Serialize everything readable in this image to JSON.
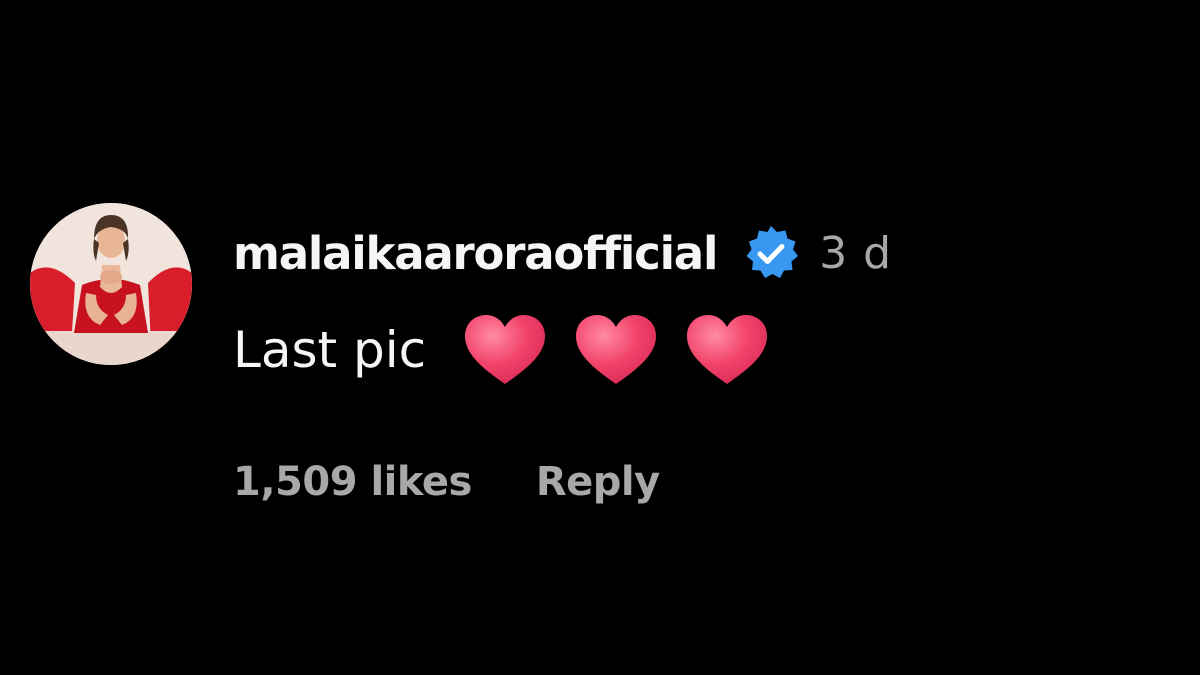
{
  "comment": {
    "avatar_icon": "profile-photo-avatar",
    "username": "malaikaaroraofficial",
    "verified_icon": "verified-badge-icon",
    "time_ago": "3 d",
    "text": "Last pic",
    "emojis": [
      "red-heart-emoji",
      "red-heart-emoji",
      "red-heart-emoji"
    ],
    "likes": "1,509 likes",
    "reply_label": "Reply"
  },
  "colors": {
    "background": "#000000",
    "primary_text": "#f5f5f5",
    "secondary_text": "#a8a8a8",
    "verified_blue": "#3897f0",
    "heart": "#f2446b"
  }
}
